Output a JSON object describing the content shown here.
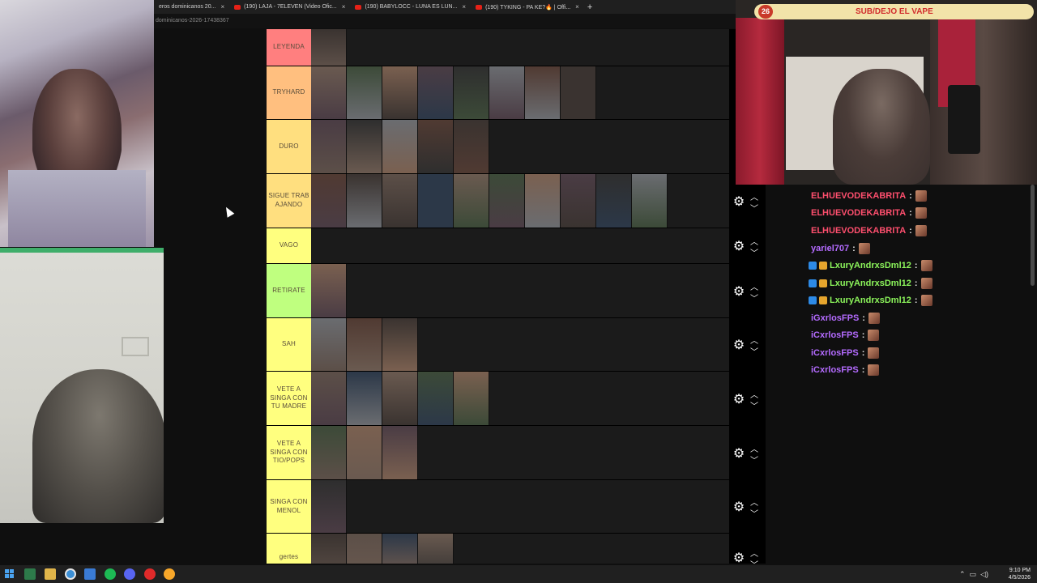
{
  "browser": {
    "tabs": [
      {
        "label": "eros dominicanos 20..."
      },
      {
        "label": "(190) LAJA - 7ELEVEN (Video Ofic..."
      },
      {
        "label": "(190) BABYLOCC - LUNA ES LUN..."
      },
      {
        "label": "(190) TYKING - PA KE?🔥 | Offi..."
      }
    ],
    "new_tab": "+",
    "close": "×",
    "url": "dominicanos-2026-17438367"
  },
  "tierlist": {
    "tiers": [
      {
        "label": "LEYENDA",
        "color": "#ff7f7f",
        "items": 1
      },
      {
        "label": "TRYHARD",
        "color": "#ffbf7f",
        "items": 8
      },
      {
        "label": "DURO",
        "color": "#ffdf7f",
        "items": 5
      },
      {
        "label": "SIGUE TRAB AJANDO",
        "color": "#ffdf7f",
        "items": 10
      },
      {
        "label": "VAGO",
        "color": "#ffff7f",
        "items": 0
      },
      {
        "label": "RETIRATE",
        "color": "#bfff7f",
        "items": 1
      },
      {
        "label": "SAH",
        "color": "#ffff7f",
        "items": 3
      },
      {
        "label": "VETE A SINGA CON TU MADRE",
        "color": "#ffff7f",
        "items": 5
      },
      {
        "label": "VETE A SINGA CON TIO/POPS",
        "color": "#ffff7f",
        "items": 3
      },
      {
        "label": "SINGA CON MENOL",
        "color": "#ffff7f",
        "items": 1
      },
      {
        "label": "gertes",
        "color": "#ffff7f",
        "items": 4
      }
    ]
  },
  "stream_overlay": {
    "count": "26",
    "banner": "SUB/DEJO EL VAPE"
  },
  "chat": {
    "messages": [
      {
        "user": "ELHUEVODEKABRITA",
        "color": "#ff4f6e"
      },
      {
        "user": "ELHUEVODEKABRITA",
        "color": "#ff4f6e"
      },
      {
        "user": "ELHUEVODEKABRITA",
        "color": "#ff4f6e"
      },
      {
        "user": "yariel707",
        "color": "#b46bff"
      },
      {
        "user": "LxuryAndrxsDml12",
        "color": "#8cf55b"
      },
      {
        "user": "LxuryAndrxsDml12",
        "color": "#8cf55b"
      },
      {
        "user": "LxuryAndrxsDml12",
        "color": "#8cf55b"
      },
      {
        "user": "iGxrlosFPS",
        "color": "#b46bff"
      },
      {
        "user": "iCxrlosFPS",
        "color": "#b46bff"
      },
      {
        "user": "iCxrlosFPS",
        "color": "#b46bff"
      },
      {
        "user": "iCxrlosFPS",
        "color": "#b46bff"
      }
    ]
  },
  "taskbar": {
    "time": "9:10 PM",
    "date": "4/5/2026"
  }
}
